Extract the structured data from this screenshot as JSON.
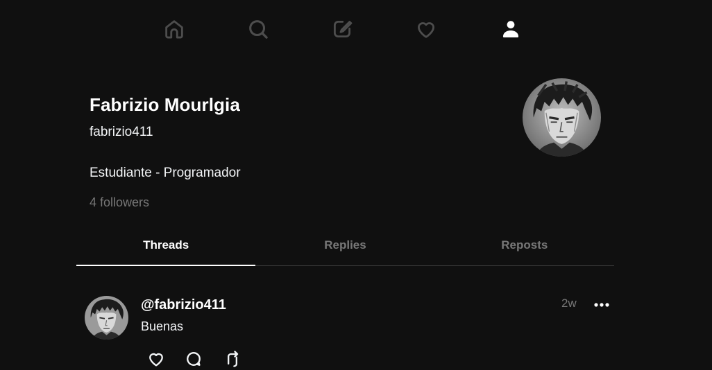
{
  "nav": {
    "items": [
      {
        "icon": "home-icon"
      },
      {
        "icon": "search-icon"
      },
      {
        "icon": "compose-icon"
      },
      {
        "icon": "heart-icon"
      },
      {
        "icon": "profile-icon"
      }
    ],
    "active": "profile-icon"
  },
  "profile": {
    "name": "Fabrizio Mourlgia",
    "handle": "fabrizio411",
    "bio": "Estudiante - Programador",
    "followers": "4 followers"
  },
  "tabs": [
    {
      "label": "Threads",
      "active": true
    },
    {
      "label": "Replies",
      "active": false
    },
    {
      "label": "Reposts",
      "active": false
    }
  ],
  "post": {
    "user": "@fabrizio411",
    "text": "Buenas",
    "time": "2w",
    "actions": [
      {
        "icon": "heart-icon"
      },
      {
        "icon": "comment-icon"
      },
      {
        "icon": "repost-icon"
      }
    ]
  },
  "colors": {
    "background": "#101010",
    "text_primary": "#f3f5f7",
    "text_secondary": "#777777",
    "divider": "#3a3a3a"
  }
}
